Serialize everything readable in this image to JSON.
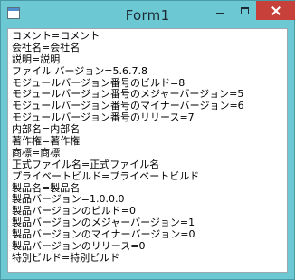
{
  "window": {
    "title": "Form1"
  },
  "colors": {
    "title_bar": "#6cc9d4",
    "close_button": "#c7403a"
  },
  "icons": {
    "app": "window-icon",
    "minimize": "minimize-icon",
    "maximize": "maximize-icon",
    "close": "close-icon"
  },
  "lines": [
    "コメント=コメント",
    "会社名=会社名",
    "説明=説明",
    "ファイル バージョン=5.6.7.8",
    "モジュールバージョン番号のビルド=8",
    "モジュールバージョン番号のメジャーバージョン=5",
    "モジュールバージョン番号のマイナーバージョン=6",
    "モジュールバージョン番号のリリース=7",
    "内部名=内部名",
    "著作権=著作権",
    "商標=商標",
    "正式ファイル名=正式ファイル名",
    "プライベートビルド=プライベートビルド",
    "製品名=製品名",
    "製品バージョン=1.0.0.0",
    "製品バージョンのビルド=0",
    "製品バージョンのメジャーバージョン=1",
    "製品バージョンのマイナーバージョン=0",
    "製品バージョンのリリース=0",
    "特別ビルド=特別ビルド"
  ]
}
